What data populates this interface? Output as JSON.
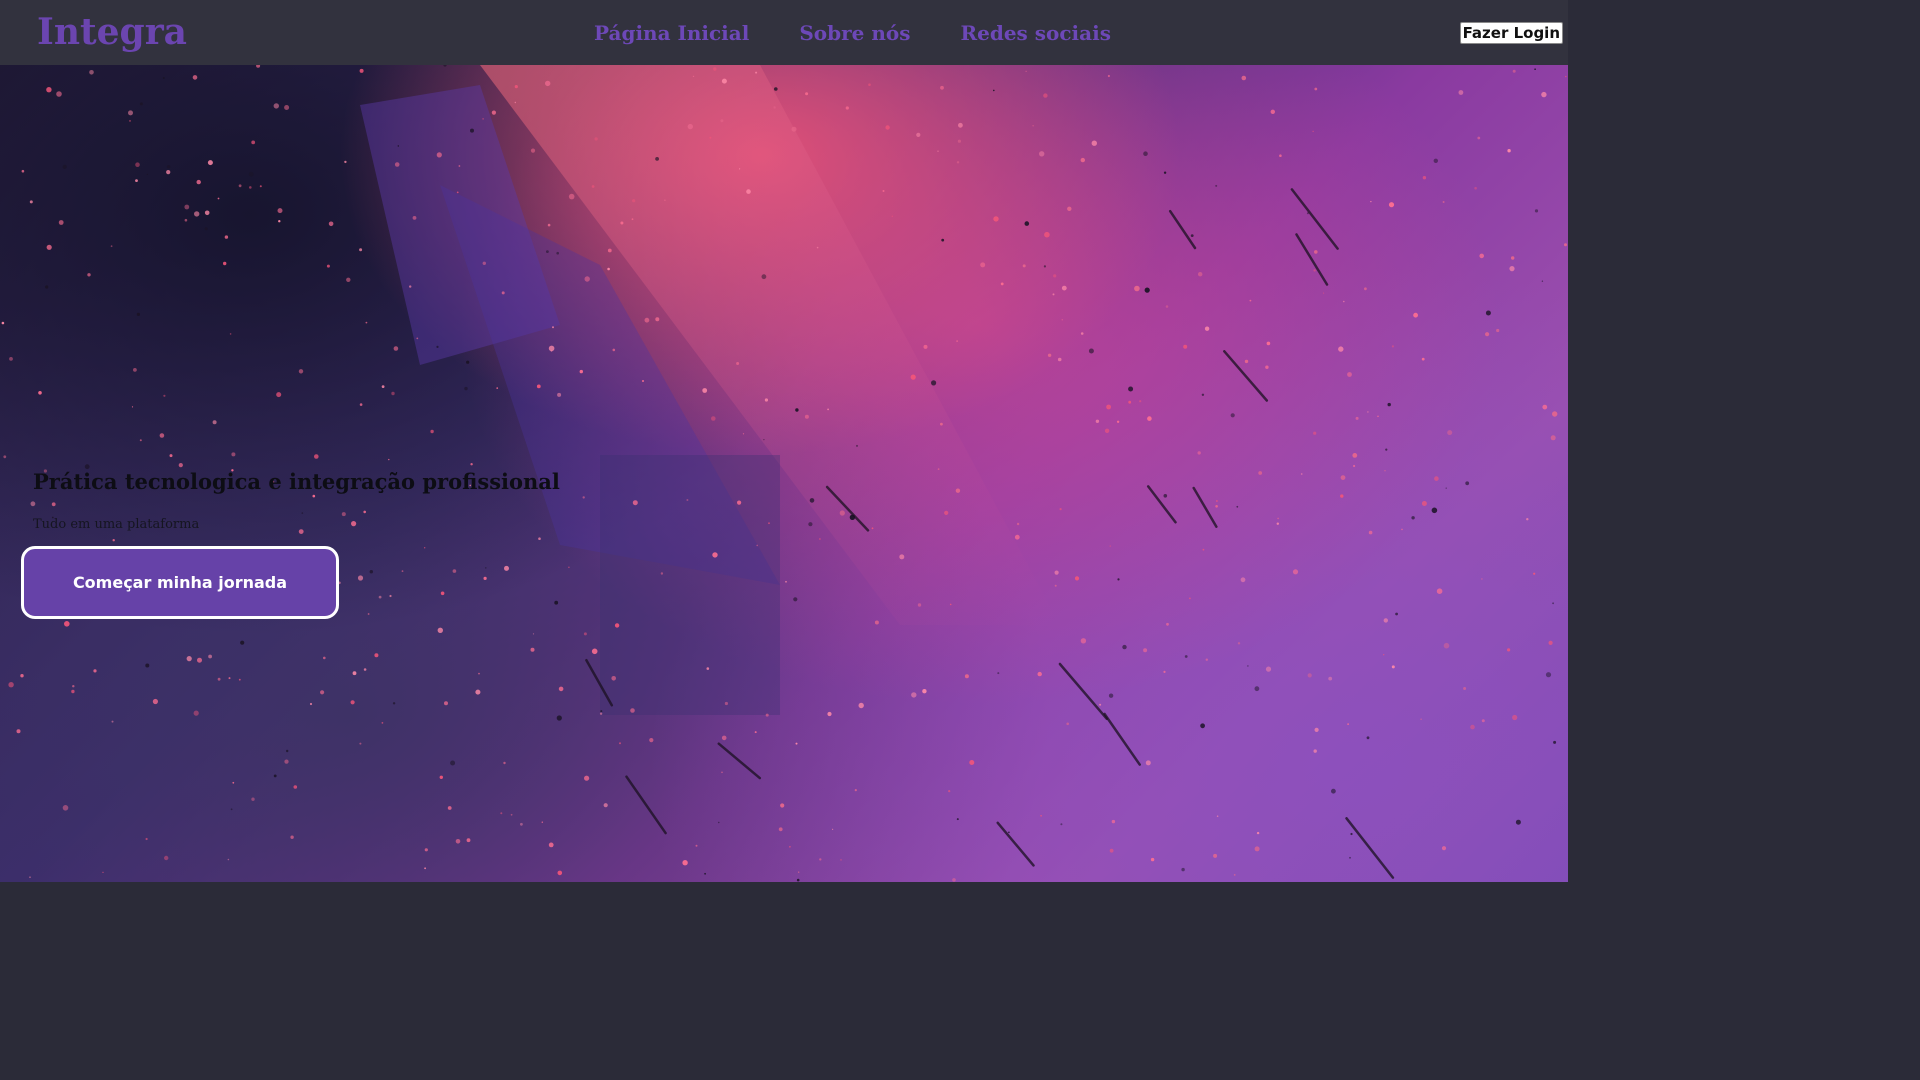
{
  "header": {
    "brand": "Integra",
    "nav": [
      {
        "label": "Página Inicial"
      },
      {
        "label": "Sobre nós"
      },
      {
        "label": "Redes sociais"
      }
    ],
    "login_label": "Fazer Login"
  },
  "hero": {
    "title": "Prática tecnologica e integração profissional",
    "subtitle": "Tudo em uma plataforma",
    "cta_label": "Começar minha jornada",
    "background": "abstract-purple-pink-splatter-image"
  },
  "colors": {
    "topbar": "#32323e",
    "brand": "#6b45b0",
    "nav_link": "#6d48b8",
    "cta_bg": "#6642a8",
    "cta_border": "#ffffff"
  }
}
